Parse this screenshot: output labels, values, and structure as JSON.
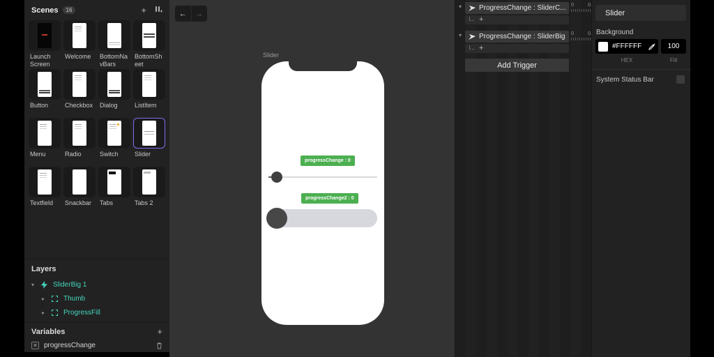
{
  "sidebar": {
    "scenes_title": "Scenes",
    "scenes_count": "16",
    "add_icon": "+",
    "scenes": [
      {
        "label": "Launch Screen",
        "variant": "dark"
      },
      {
        "label": "Welcome",
        "variant": "lines-top"
      },
      {
        "label": "BottomNavBars",
        "variant": "dots-bottom"
      },
      {
        "label": "BottomSheet",
        "variant": "bars-mid"
      },
      {
        "label": "Button",
        "variant": "bar-bottom"
      },
      {
        "label": "Checkbox",
        "variant": "lines-top"
      },
      {
        "label": "Dialog",
        "variant": "bar-bottom"
      },
      {
        "label": "ListItem",
        "variant": "lines-top"
      },
      {
        "label": "Menu",
        "variant": "lines-top"
      },
      {
        "label": "Radio",
        "variant": "lines-top"
      },
      {
        "label": "Switch",
        "variant": "switch"
      },
      {
        "label": "Slider",
        "variant": "lines-mid",
        "selected": true
      },
      {
        "label": "Textfield",
        "variant": "lines-top"
      },
      {
        "label": "Snackbar",
        "variant": "plain"
      },
      {
        "label": "Tabs",
        "variant": "bar-top"
      },
      {
        "label": "Tabs 2",
        "variant": "bar-top-light"
      }
    ],
    "layers_title": "Layers",
    "layers": [
      {
        "name": "SliderBig 1",
        "caret": "▾"
      },
      {
        "name": "Thumb",
        "caret": "▸"
      },
      {
        "name": "ProgressFill",
        "caret": "▸"
      }
    ],
    "variables_title": "Variables",
    "variables_add": "+",
    "variables": [
      {
        "name": "progressChange",
        "icon_glyph": "✕"
      }
    ]
  },
  "canvas": {
    "back_arrow": "←",
    "forward_arrow": "→",
    "scene_label": "Slider",
    "badge_top": "progressChange : 0",
    "badge_bottom": "progressChange2 : 0"
  },
  "triggers": {
    "items": [
      {
        "collapse": "▾",
        "label": "ProgressChange : SliderC...",
        "add": "+",
        "ruler_start": "0",
        "ruler_end": "0."
      },
      {
        "collapse": "▾",
        "label": "ProgressChange : SliderBig",
        "add": "+",
        "ruler_start": "0",
        "ruler_end": "0."
      }
    ],
    "add_button": "Add Trigger"
  },
  "properties": {
    "title": "Slider",
    "background_label": "Background",
    "hex_value": "#FFFFFF",
    "hex_label": "HEX",
    "fill_value": "100",
    "fill_label": "Fill",
    "status_bar_label": "System Status Bar"
  },
  "colors": {
    "accent_teal": "#45d6bd",
    "badge_green": "#4caf50",
    "selection_purple": "#7b6cf0",
    "background_swatch": "#FFFFFF"
  }
}
